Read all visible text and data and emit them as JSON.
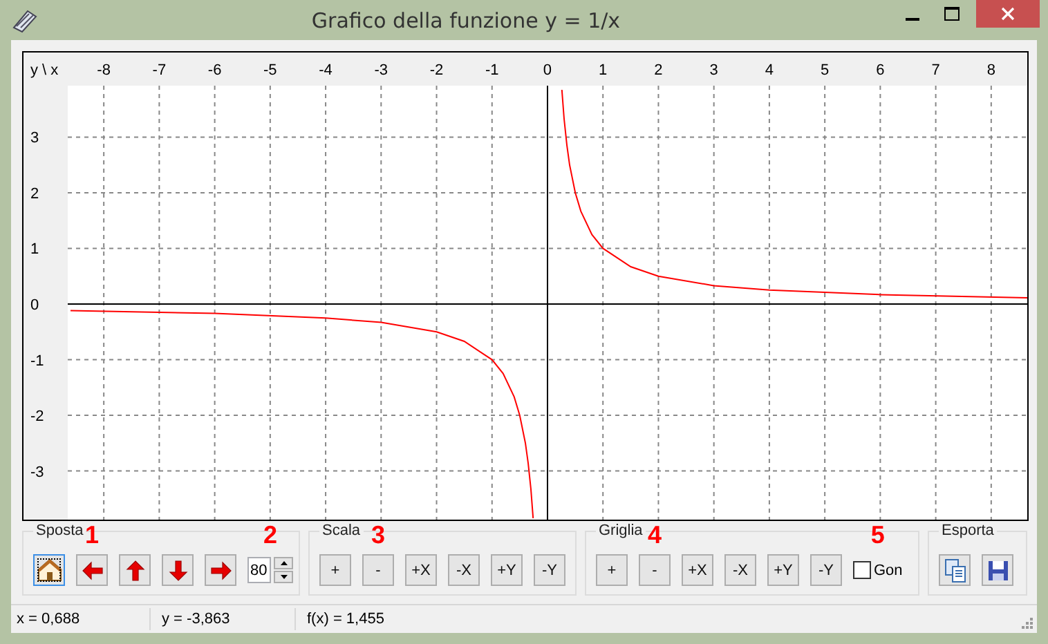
{
  "window": {
    "title": "Grafico della funzione y = 1/x"
  },
  "plot": {
    "corner_label": "y \\ x",
    "chart_data": {
      "type": "line",
      "x": [
        -8.6,
        -6,
        -4,
        -3,
        -2,
        -1.5,
        -1,
        -0.8,
        -0.6,
        -0.5,
        -0.4,
        -0.35,
        -0.3,
        -0.26,
        0,
        0.26,
        0.3,
        0.35,
        0.4,
        0.5,
        0.6,
        0.8,
        1,
        1.5,
        2,
        3,
        4,
        6,
        8.7
      ],
      "series": [
        {
          "color": "#ff0000",
          "values": [
            -0.12,
            -0.17,
            -0.25,
            -0.33,
            -0.5,
            -0.67,
            -1,
            -1.25,
            -1.67,
            -2,
            -2.5,
            -2.86,
            -3.33,
            -3.85,
            null,
            3.85,
            3.33,
            2.86,
            2.5,
            2,
            1.67,
            1.25,
            1,
            0.67,
            0.5,
            0.33,
            0.25,
            0.17,
            0.11
          ]
        }
      ],
      "grid": true,
      "xlim": [
        -8.65,
        8.7
      ],
      "ylim": [
        -3.925,
        3.925
      ],
      "xticks": [
        -8,
        -7,
        -6,
        -5,
        -4,
        -3,
        -2,
        -1,
        0,
        1,
        2,
        3,
        4,
        5,
        6,
        7,
        8
      ],
      "yticks": [
        -3,
        -2,
        -1,
        0,
        1,
        2,
        3
      ]
    }
  },
  "groups": [
    {
      "title": "Sposta",
      "items": [
        {
          "kind": "home",
          "focused": true
        },
        {
          "kind": "left",
          "note": "1"
        },
        {
          "kind": "up"
        },
        {
          "kind": "down"
        },
        {
          "kind": "right"
        },
        {
          "kind": "spin",
          "value": "80",
          "note": "2"
        }
      ]
    },
    {
      "title": "Scala",
      "items": [
        {
          "kind": "text",
          "label": "+"
        },
        {
          "kind": "text",
          "label": "-",
          "note": "3"
        },
        {
          "kind": "text",
          "label": "+X"
        },
        {
          "kind": "text",
          "label": "-X"
        },
        {
          "kind": "text",
          "label": "+Y"
        },
        {
          "kind": "text",
          "label": "-Y"
        }
      ]
    },
    {
      "title": "Griglia",
      "items": [
        {
          "kind": "text",
          "label": "+"
        },
        {
          "kind": "text",
          "label": "-",
          "note": "4"
        },
        {
          "kind": "text",
          "label": "+X"
        },
        {
          "kind": "text",
          "label": "-X"
        },
        {
          "kind": "text",
          "label": "+Y"
        },
        {
          "kind": "text",
          "label": "-Y"
        },
        {
          "kind": "check",
          "label": "Gon",
          "checked": false,
          "note": "5"
        }
      ]
    },
    {
      "title": "Esporta",
      "items": [
        {
          "kind": "copy"
        },
        {
          "kind": "save"
        }
      ]
    }
  ],
  "status_bar": [
    "x = 0,688",
    "y = -3,863",
    "f(x) = 1,455"
  ]
}
